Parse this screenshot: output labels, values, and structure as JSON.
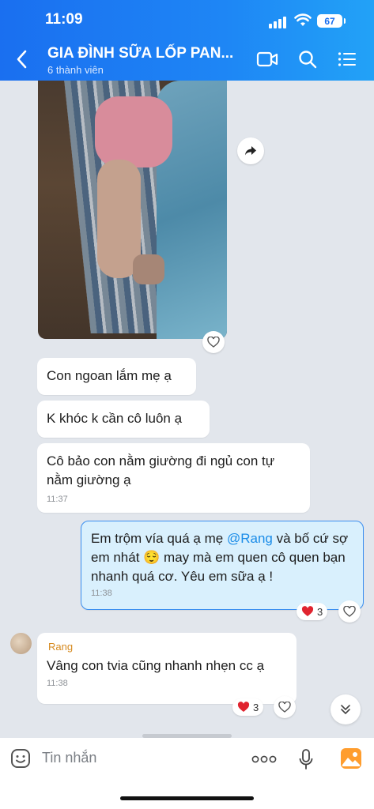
{
  "status": {
    "time": "11:09",
    "battery": "67"
  },
  "header": {
    "title": "GIA ĐÌNH SỮA LỐP PAN...",
    "subtitle": "6 thành viên"
  },
  "messages": {
    "m1": "Con ngoan lắm mẹ ạ",
    "m2": "K khóc k cần cô luôn ạ",
    "m3": "Cô bảo con nằm giường đi ngủ con tự nằm giường ạ",
    "m3_time": "11:37",
    "mine_pre": "Em trộm vía quá ạ mẹ ",
    "mine_mention": "@Rang",
    "mine_post": "  và bố cứ sợ em nhát 😌 may mà em quen cô quen bạn nhanh quá cơ. Yêu em sữa ạ !",
    "mine_time": "11:38",
    "mine_react_count": "3",
    "sender": "Rang",
    "reply": "Vâng con tvia cũng nhanh nhẹn cc ạ",
    "reply_time": "11:38",
    "reply_react_count": "3"
  },
  "input": {
    "placeholder": "Tin nhắn",
    "more": "ooo"
  },
  "colors": {
    "accent": "#1a6ff0",
    "mention": "#1a8ce8",
    "sender": "#d68a1f",
    "heart": "#e0242f"
  }
}
